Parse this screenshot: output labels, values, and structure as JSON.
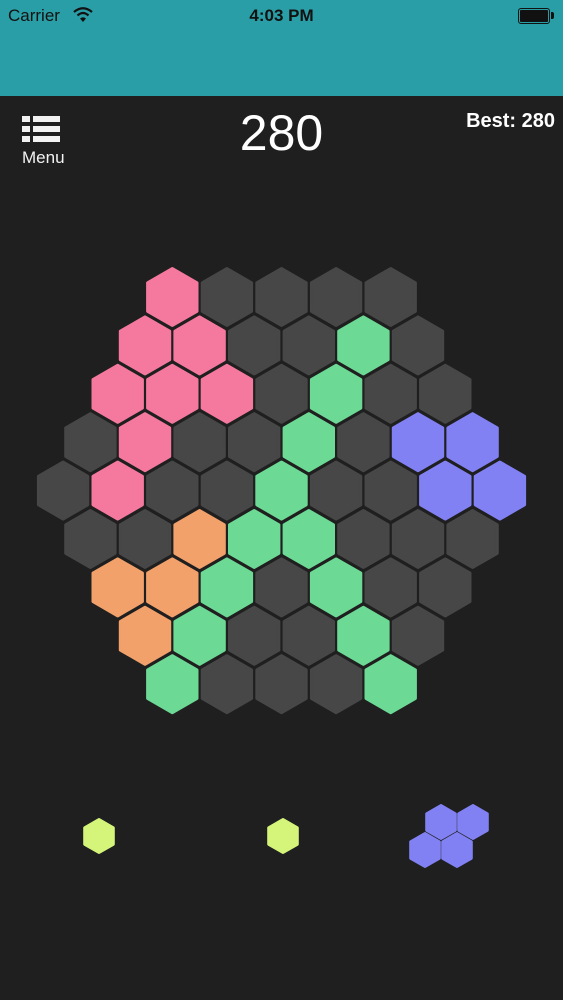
{
  "status_bar": {
    "carrier": "Carrier",
    "time": "4:03 PM",
    "wifi_icon": "wifi-icon",
    "battery_icon": "battery-icon",
    "background": "#2a9ea6"
  },
  "header": {
    "menu_label": "Menu",
    "menu_icon": "list-icon",
    "score": "280",
    "best": "Best: 280"
  },
  "colors": {
    "empty": "#474747",
    "pink": "#f5799f",
    "green": "#6cd995",
    "purple": "#8181f3",
    "orange": "#f2a16b",
    "lime": "#d4f57a"
  },
  "board": {
    "rows": [
      [
        "pink",
        "empty",
        "empty",
        "empty",
        "empty"
      ],
      [
        "pink",
        "pink",
        "empty",
        "empty",
        "green",
        "empty"
      ],
      [
        "pink",
        "pink",
        "pink",
        "empty",
        "green",
        "empty",
        "empty"
      ],
      [
        "empty",
        "pink",
        "empty",
        "empty",
        "green",
        "empty",
        "purple",
        "purple"
      ],
      [
        "empty",
        "pink",
        "empty",
        "empty",
        "green",
        "empty",
        "empty",
        "purple",
        "purple"
      ],
      [
        "empty",
        "empty",
        "orange",
        "green",
        "green",
        "empty",
        "empty",
        "empty"
      ],
      [
        "orange",
        "orange",
        "green",
        "empty",
        "green",
        "empty",
        "empty"
      ],
      [
        "orange",
        "green",
        "empty",
        "empty",
        "green",
        "empty"
      ],
      [
        "green",
        "empty",
        "empty",
        "empty",
        "green"
      ]
    ]
  },
  "pieces": [
    {
      "name": "single-lime-piece",
      "color": "lime",
      "cells": [
        [
          0,
          0
        ]
      ]
    },
    {
      "name": "single-lime-piece-2",
      "color": "lime",
      "cells": [
        [
          0,
          0
        ]
      ]
    },
    {
      "name": "purple-diamond-piece",
      "color": "purple",
      "cells": [
        [
          0,
          1
        ],
        [
          0,
          2
        ],
        [
          1,
          0
        ],
        [
          1,
          1
        ]
      ]
    }
  ]
}
